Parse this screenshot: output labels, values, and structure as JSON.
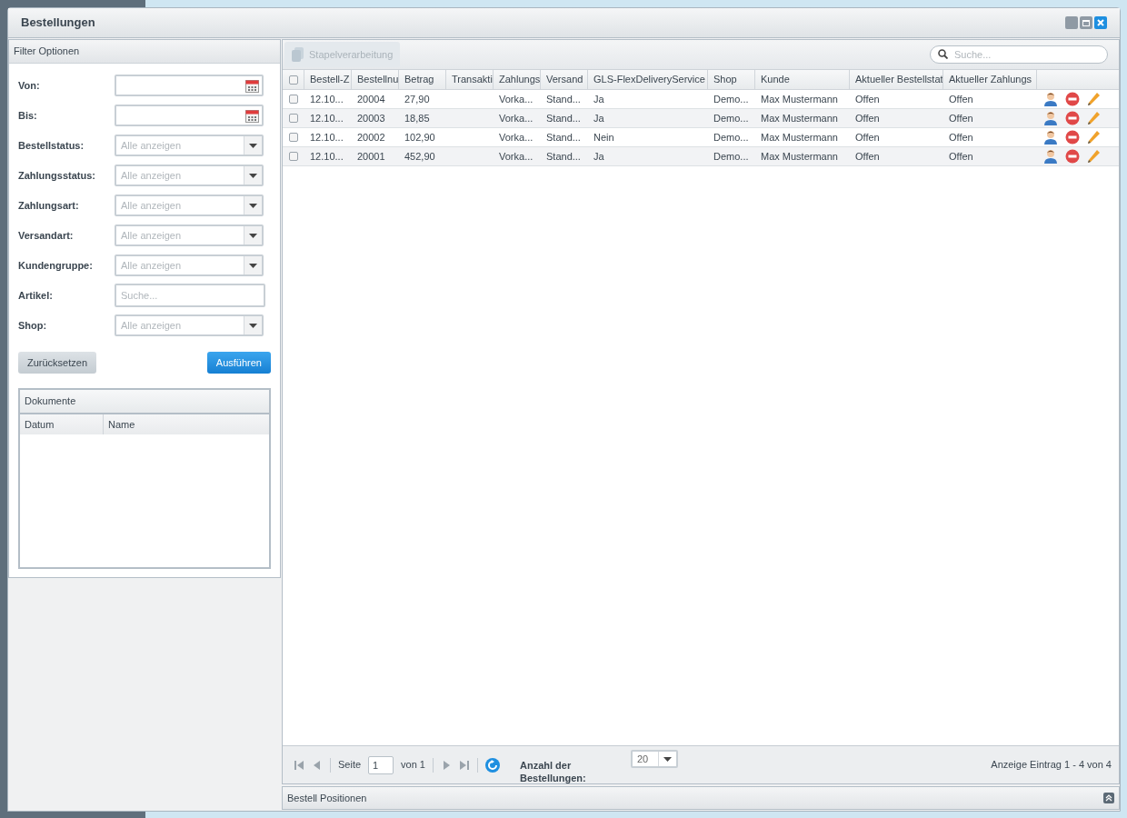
{
  "window": {
    "title": "Bestellungen"
  },
  "filter_panel": {
    "title": "Filter Optionen",
    "fields": [
      {
        "label": "Von:",
        "kind": "date"
      },
      {
        "label": "Bis:",
        "kind": "date"
      },
      {
        "label": "Bestellstatus:",
        "kind": "select",
        "placeholder": "Alle anzeigen"
      },
      {
        "label": "Zahlungsstatus:",
        "kind": "select",
        "placeholder": "Alle anzeigen"
      },
      {
        "label": "Zahlungsart:",
        "kind": "select",
        "placeholder": "Alle anzeigen"
      },
      {
        "label": "Versandart:",
        "kind": "select",
        "placeholder": "Alle anzeigen"
      },
      {
        "label": "Kundengruppe:",
        "kind": "select",
        "placeholder": "Alle anzeigen"
      },
      {
        "label": "Artikel:",
        "kind": "text",
        "placeholder": "Suche..."
      },
      {
        "label": "Shop:",
        "kind": "select",
        "placeholder": "Alle anzeigen"
      }
    ],
    "reset_button": "Zurücksetzen",
    "run_button": "Ausführen",
    "documents": {
      "title": "Dokumente",
      "columns": [
        "Datum",
        "Name"
      ]
    }
  },
  "toolbar": {
    "batch_button": "Stapelverarbeitung",
    "search_placeholder": "Suche..."
  },
  "table": {
    "header_checked": false,
    "columns": [
      "Bestell-Z",
      "Bestellnu",
      "Betrag",
      "Transakti",
      "Zahlungs",
      "Versand",
      "GLS-FlexDeliveryService",
      "Shop",
      "Kunde",
      "Aktueller Bestellstat",
      "Aktueller Zahlungs"
    ],
    "rows": [
      {
        "checked": false,
        "cells": [
          "12.10...",
          "20004",
          "27,90",
          "",
          "Vorka...",
          "Stand...",
          "Ja",
          "Demo...",
          "Max Mustermann",
          "Offen",
          "Offen"
        ]
      },
      {
        "checked": false,
        "cells": [
          "12.10...",
          "20003",
          "18,85",
          "",
          "Vorka...",
          "Stand...",
          "Ja",
          "Demo...",
          "Max Mustermann",
          "Offen",
          "Offen"
        ]
      },
      {
        "checked": false,
        "cells": [
          "12.10...",
          "20002",
          "102,90",
          "",
          "Vorka...",
          "Stand...",
          "Nein",
          "Demo...",
          "Max Mustermann",
          "Offen",
          "Offen"
        ]
      },
      {
        "checked": false,
        "cells": [
          "12.10...",
          "20001",
          "452,90",
          "",
          "Vorka...",
          "Stand...",
          "Ja",
          "Demo...",
          "Max Mustermann",
          "Offen",
          "Offen"
        ]
      }
    ]
  },
  "pagination": {
    "page_label": "Seite",
    "page": "1",
    "of": "von 1",
    "count_label": "Anzahl der Bestellungen:",
    "count": "20",
    "summary": "Anzeige Eintrag 1 - 4 von 4"
  },
  "bottom_panel": {
    "title": "Bestell Positionen"
  }
}
